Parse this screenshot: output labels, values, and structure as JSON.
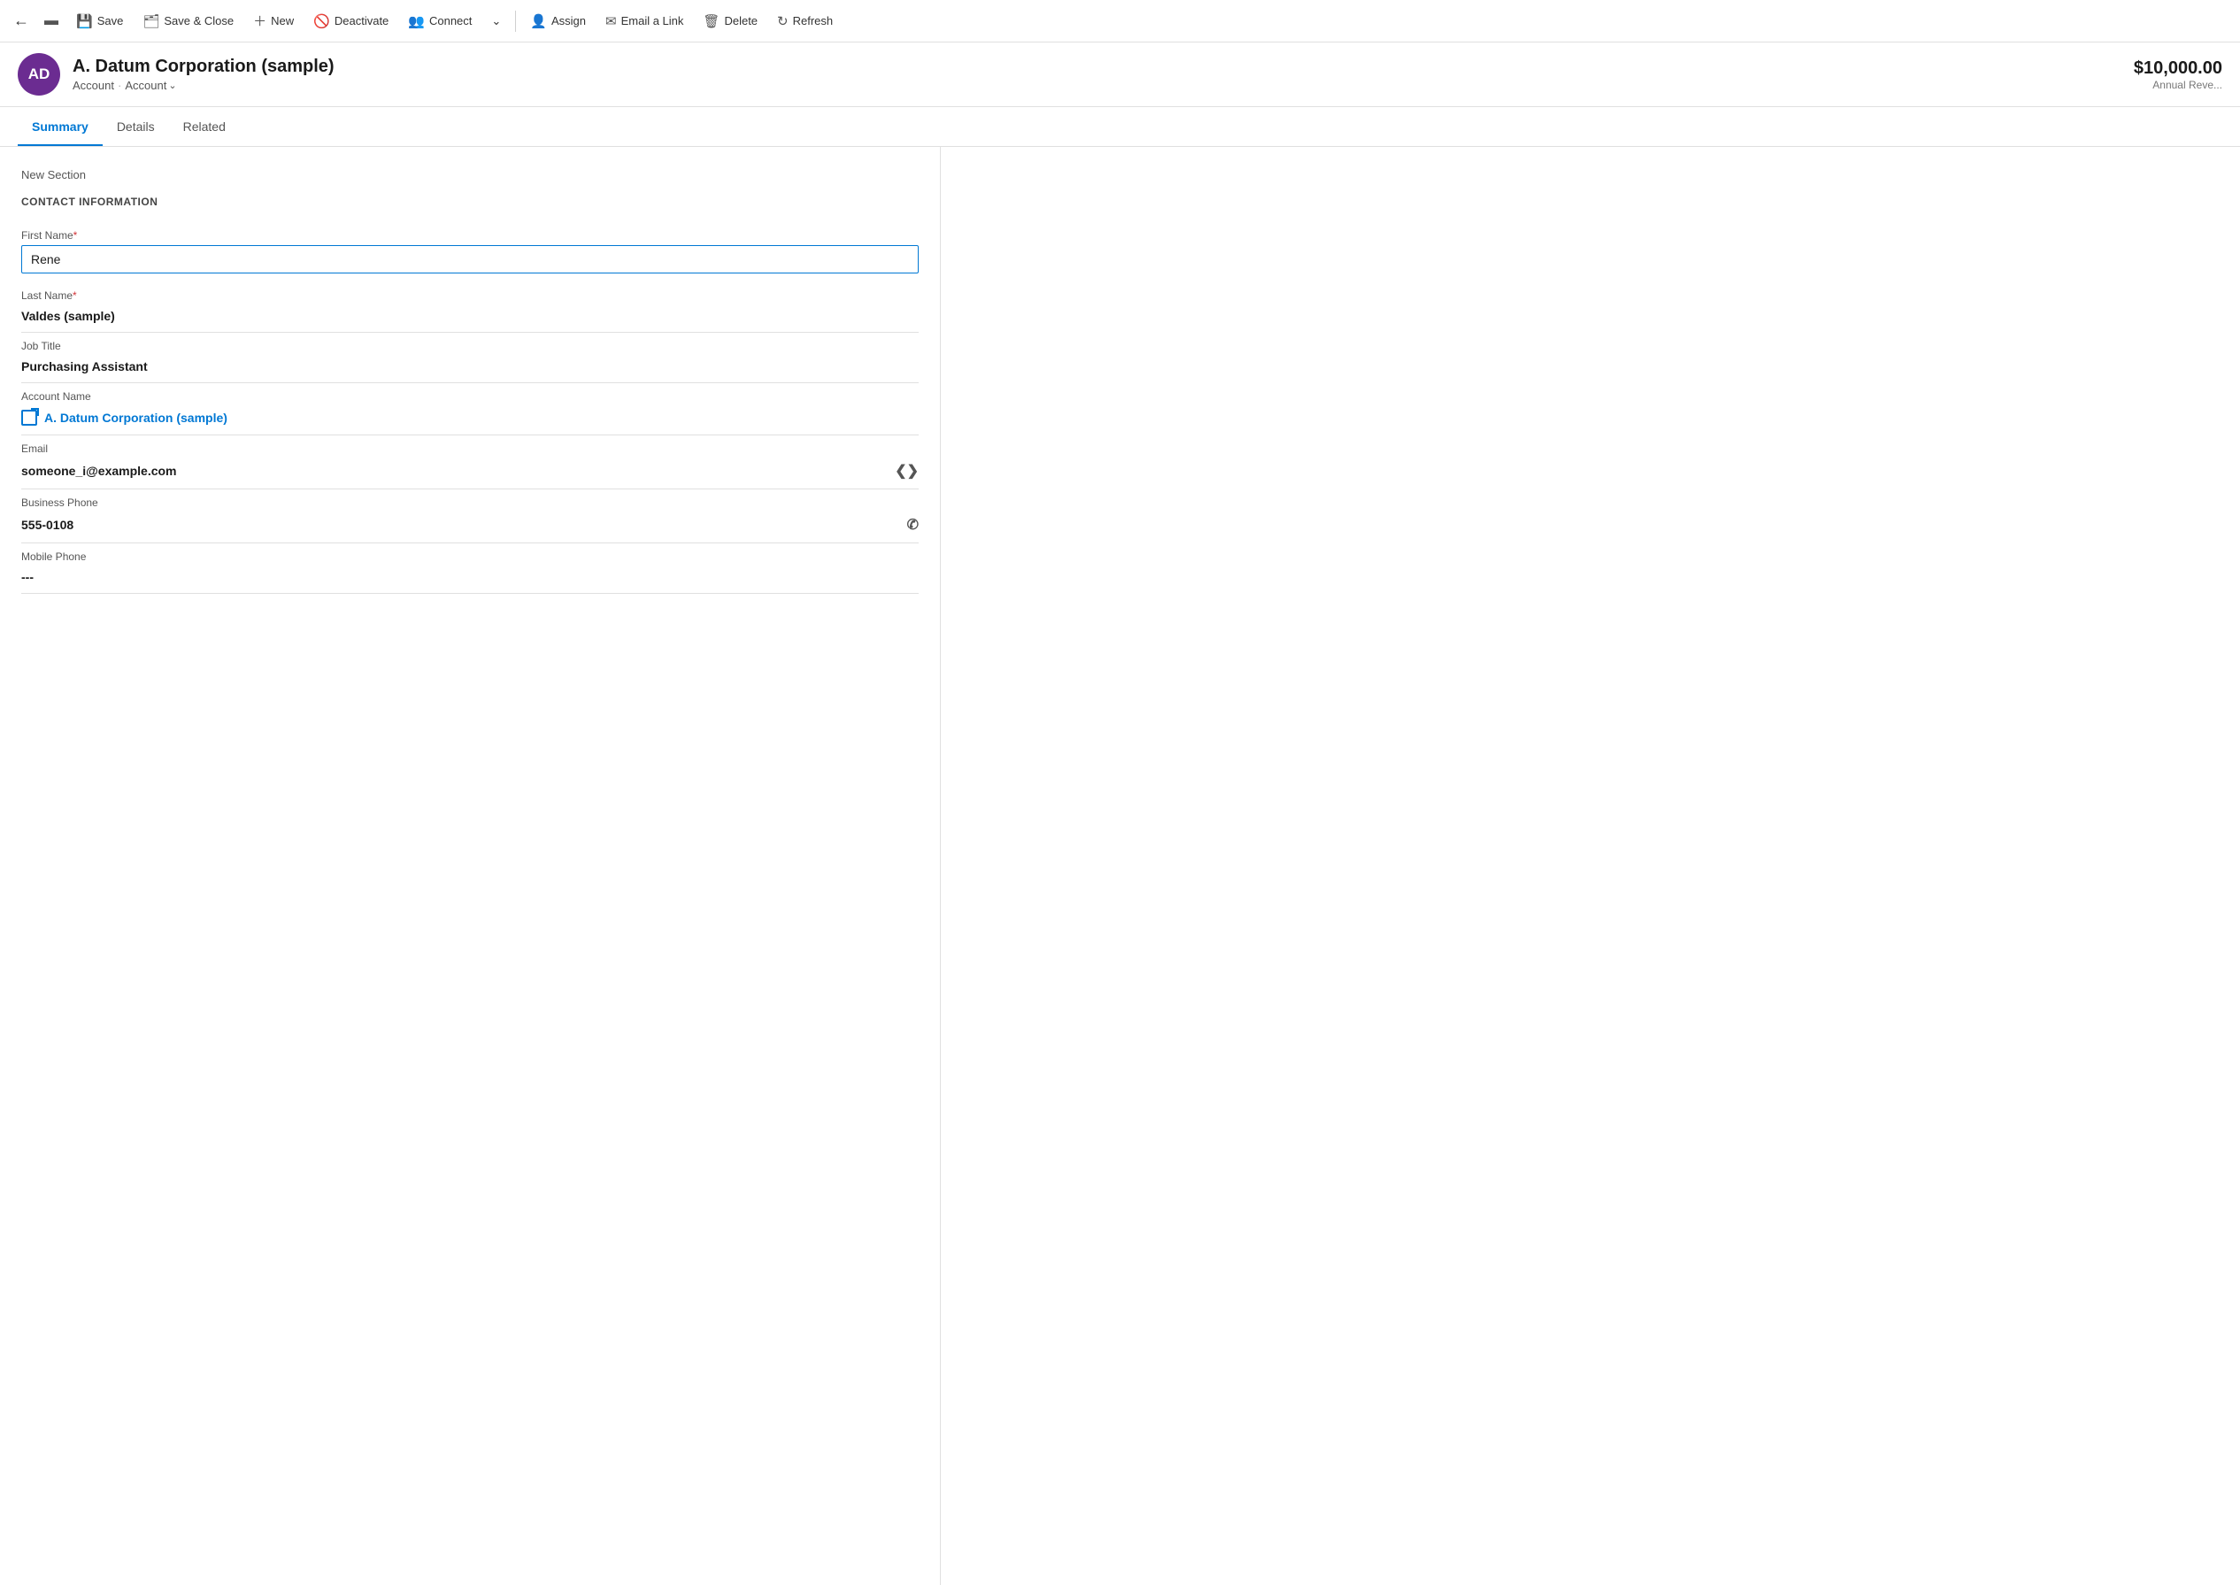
{
  "toolbar": {
    "back_label": "←",
    "panel_icon": "☰",
    "save_label": "Save",
    "save_close_label": "Save & Close",
    "new_label": "New",
    "deactivate_label": "Deactivate",
    "connect_label": "Connect",
    "more_label": "⌄",
    "assign_label": "Assign",
    "email_link_label": "Email a Link",
    "delete_label": "Delete",
    "refresh_label": "Refresh"
  },
  "header": {
    "avatar_initials": "AD",
    "avatar_bg": "#6b2c91",
    "title": "A. Datum Corporation (sample)",
    "breadcrumb1": "Account",
    "breadcrumb2": "Account",
    "annual_revenue": "$10,000.00",
    "annual_revenue_label": "Annual Reve..."
  },
  "tabs": [
    {
      "label": "Summary",
      "active": true
    },
    {
      "label": "Details",
      "active": false
    },
    {
      "label": "Related",
      "active": false
    }
  ],
  "form": {
    "section_label": "New Section",
    "contact_info_header": "CONTACT INFORMATION",
    "fields": [
      {
        "id": "first-name",
        "label": "First Name",
        "required": true,
        "type": "input",
        "value": "Rene"
      },
      {
        "id": "last-name",
        "label": "Last Name",
        "required": true,
        "type": "text",
        "value": "Valdes (sample)"
      },
      {
        "id": "job-title",
        "label": "Job Title",
        "required": false,
        "type": "text",
        "value": "Purchasing Assistant"
      },
      {
        "id": "account-name",
        "label": "Account Name",
        "required": false,
        "type": "link",
        "value": "A. Datum Corporation (sample)"
      },
      {
        "id": "email",
        "label": "Email",
        "required": false,
        "type": "text-action",
        "value": "someone_i@example.com",
        "action_icon": "✉"
      },
      {
        "id": "business-phone",
        "label": "Business Phone",
        "required": false,
        "type": "text-action",
        "value": "555-0108",
        "action_icon": "📞"
      },
      {
        "id": "mobile-phone",
        "label": "Mobile Phone",
        "required": false,
        "type": "text",
        "value": "---"
      }
    ]
  }
}
